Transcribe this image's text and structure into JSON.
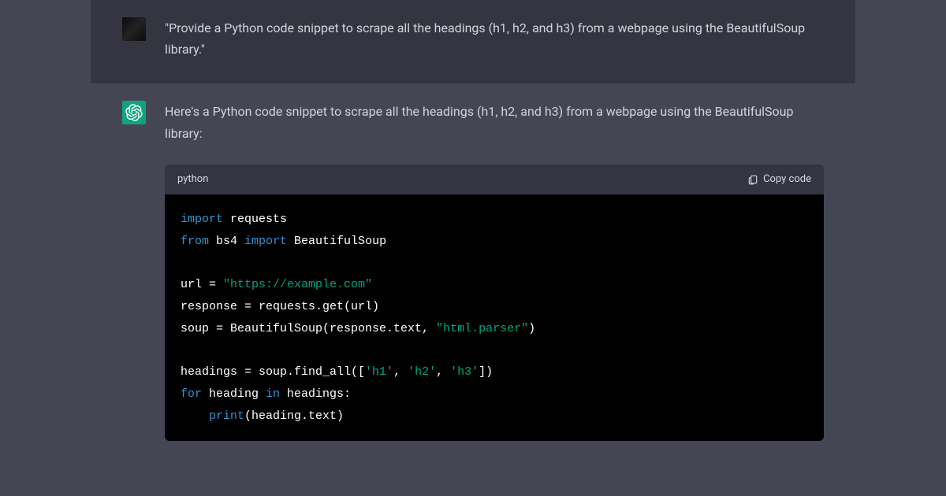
{
  "user": {
    "message": "\"Provide a Python code snippet to scrape all the headings (h1, h2, and h3) from a webpage using the BeautifulSoup library.\""
  },
  "assistant": {
    "message": "Here's a Python code snippet to scrape all the headings (h1, h2, and h3) from a webpage using the BeautifulSoup library:",
    "code_language": "python",
    "copy_label": "Copy code",
    "code_tokens": [
      {
        "t": "import",
        "c": "kw"
      },
      {
        "t": " requests",
        "c": ""
      },
      {
        "t": "\n",
        "c": ""
      },
      {
        "t": "from",
        "c": "kw"
      },
      {
        "t": " bs4 ",
        "c": ""
      },
      {
        "t": "import",
        "c": "kw"
      },
      {
        "t": " BeautifulSoup",
        "c": ""
      },
      {
        "t": "\n",
        "c": ""
      },
      {
        "t": "\n",
        "c": ""
      },
      {
        "t": "url = ",
        "c": ""
      },
      {
        "t": "\"https://example.com\"",
        "c": "str"
      },
      {
        "t": "\n",
        "c": ""
      },
      {
        "t": "response = requests.get(url)",
        "c": ""
      },
      {
        "t": "\n",
        "c": ""
      },
      {
        "t": "soup = BeautifulSoup(response.text, ",
        "c": ""
      },
      {
        "t": "\"html.parser\"",
        "c": "str"
      },
      {
        "t": ")",
        "c": ""
      },
      {
        "t": "\n",
        "c": ""
      },
      {
        "t": "\n",
        "c": ""
      },
      {
        "t": "headings = soup.find_all([",
        "c": ""
      },
      {
        "t": "'h1'",
        "c": "str"
      },
      {
        "t": ", ",
        "c": ""
      },
      {
        "t": "'h2'",
        "c": "str"
      },
      {
        "t": ", ",
        "c": ""
      },
      {
        "t": "'h3'",
        "c": "str"
      },
      {
        "t": "])",
        "c": ""
      },
      {
        "t": "\n",
        "c": ""
      },
      {
        "t": "for",
        "c": "kw"
      },
      {
        "t": " heading ",
        "c": ""
      },
      {
        "t": "in",
        "c": "kw"
      },
      {
        "t": " headings:",
        "c": ""
      },
      {
        "t": "\n",
        "c": ""
      },
      {
        "t": "    ",
        "c": ""
      },
      {
        "t": "print",
        "c": "kw2"
      },
      {
        "t": "(heading.text)",
        "c": ""
      }
    ]
  }
}
